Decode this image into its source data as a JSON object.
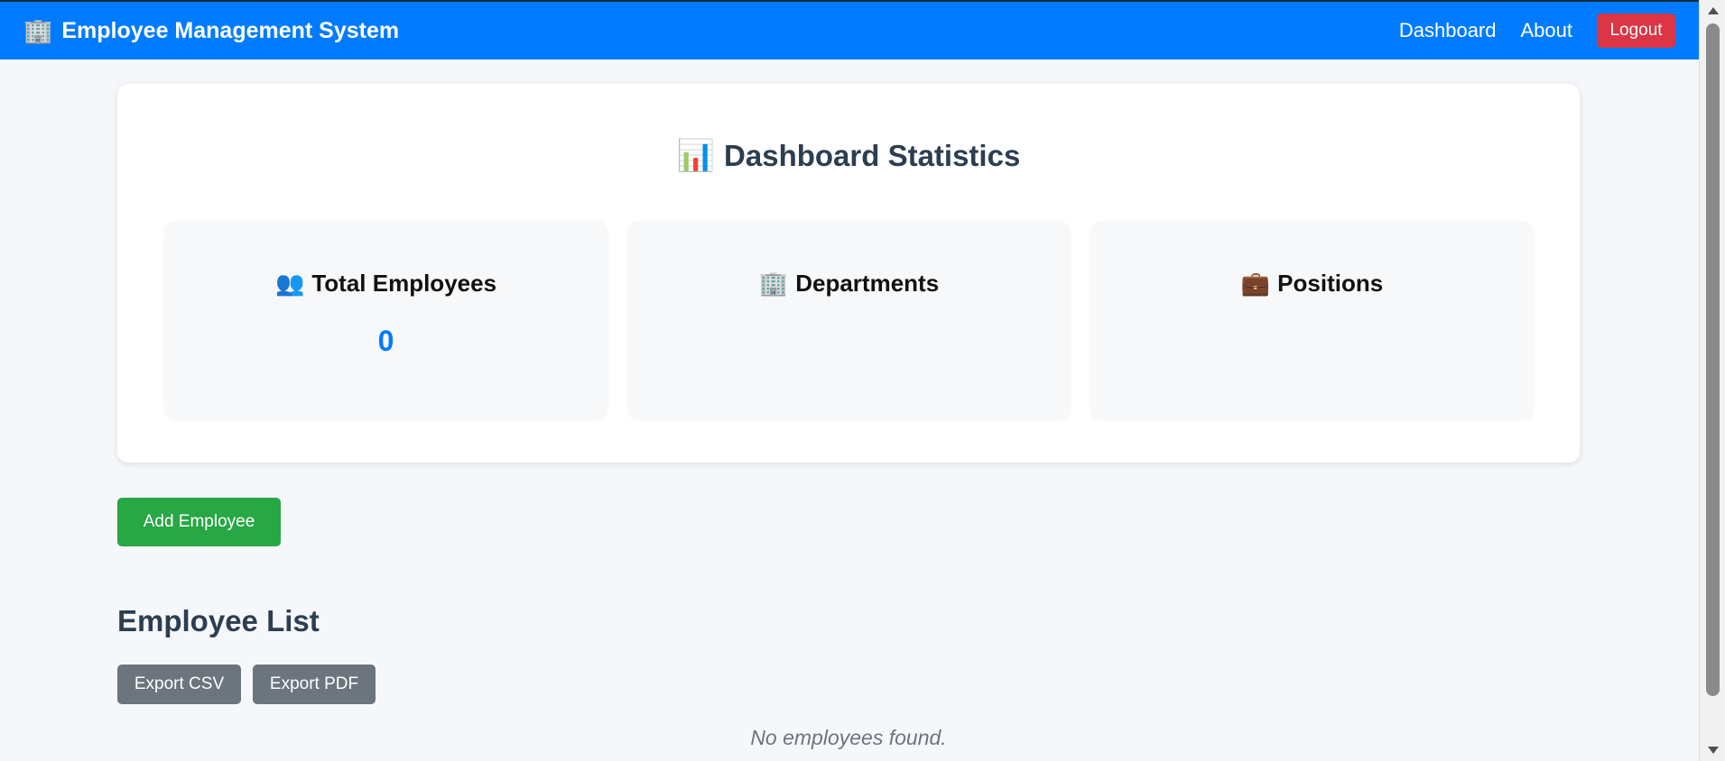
{
  "navbar": {
    "brand_icon": "🏢",
    "brand_icon_name": "office-building-icon",
    "brand_title": "Employee Management System",
    "links": [
      "Dashboard",
      "About"
    ],
    "logout_label": "Logout",
    "color": "#007bff",
    "logout_color": "#dc3545"
  },
  "stats": {
    "icon": "📊",
    "icon_name": "bar-chart-icon",
    "title": "Dashboard Statistics",
    "cards": [
      {
        "icon": "👥",
        "icon_name": "people-icon",
        "label": "Total Employees",
        "value": "0"
      },
      {
        "icon": "🏢",
        "icon_name": "office-building-icon",
        "label": "Departments",
        "value": ""
      },
      {
        "icon": "💼",
        "icon_name": "briefcase-icon",
        "label": "Positions",
        "value": ""
      }
    ],
    "value_color": "#007bff"
  },
  "actions": {
    "add_employee_label": "Add Employee",
    "add_color": "#28a745"
  },
  "employee_list": {
    "title": "Employee List",
    "export_csv_label": "Export CSV",
    "export_pdf_label": "Export PDF",
    "export_color": "#6c757d",
    "empty_message": "No employees found."
  }
}
